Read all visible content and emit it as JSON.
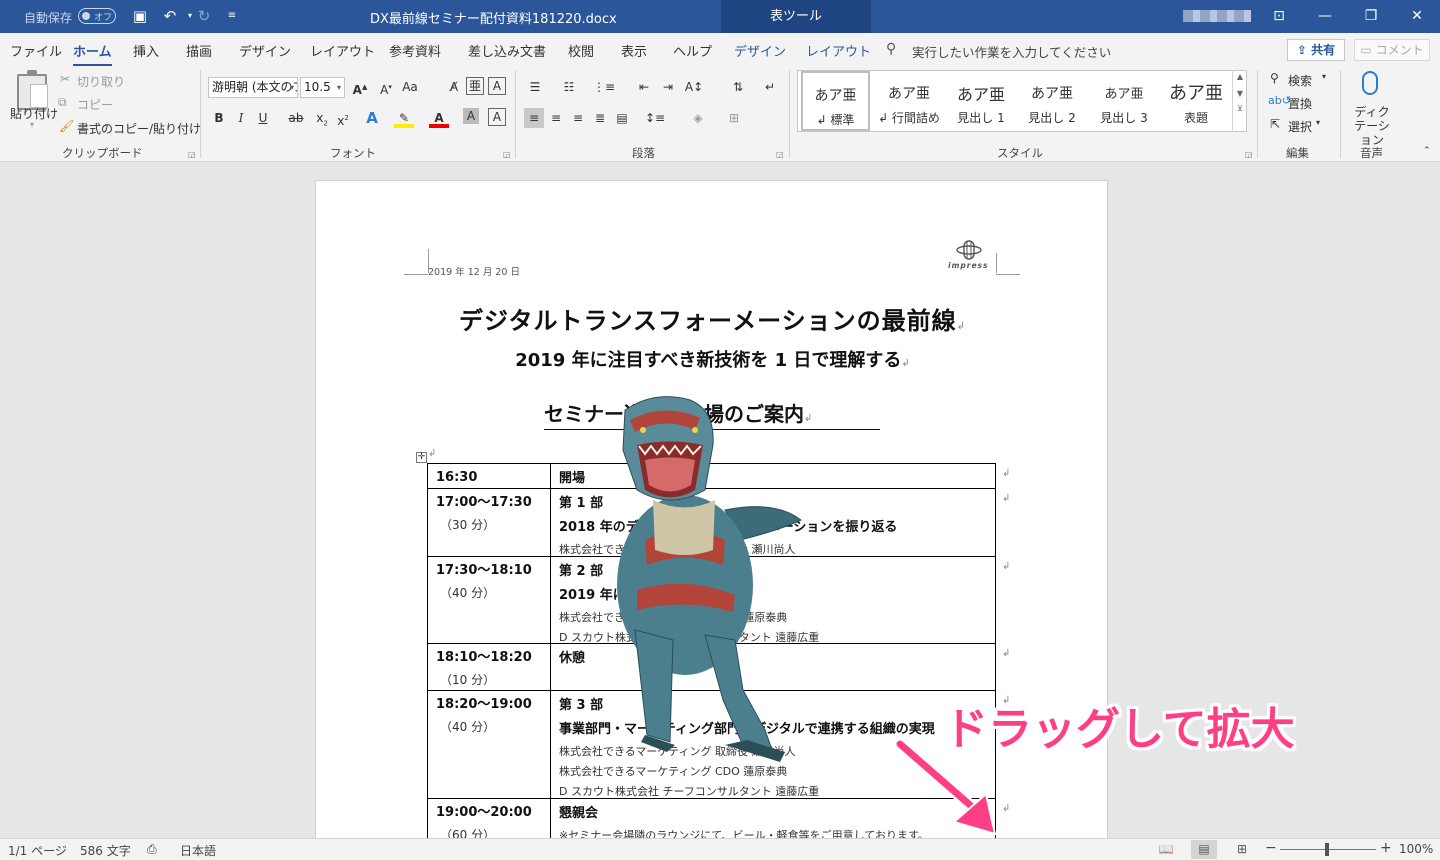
{
  "titlebar": {
    "autosave_label": "自動保存",
    "autosave_state": "オフ",
    "filename": "DX最前線セミナー配付資料181220.docx",
    "context_tab": "表ツール"
  },
  "tabs": [
    {
      "label": "ファイル"
    },
    {
      "label": "ホーム"
    },
    {
      "label": "挿入"
    },
    {
      "label": "描画"
    },
    {
      "label": "デザイン"
    },
    {
      "label": "レイアウト"
    },
    {
      "label": "参考資料"
    },
    {
      "label": "差し込み文書"
    },
    {
      "label": "校閲"
    },
    {
      "label": "表示"
    },
    {
      "label": "ヘルプ"
    },
    {
      "label": "デザイン"
    },
    {
      "label": "レイアウト"
    }
  ],
  "tell_me": "実行したい作業を入力してください",
  "share_label": "共有",
  "comment_label": "コメント",
  "clipboard": {
    "paste": "貼り付け",
    "cut": "切り取り",
    "copy": "コピー",
    "format_painter": "書式のコピー/貼り付け",
    "group": "クリップボード"
  },
  "font": {
    "name": "游明朝 (本文のフォント)",
    "size": "10.5",
    "group": "フォント"
  },
  "paragraph": {
    "group": "段落"
  },
  "styles": {
    "group": "スタイル",
    "items": [
      {
        "sample": "あア亜",
        "name": "↲ 標準"
      },
      {
        "sample": "あア亜",
        "name": "↲ 行間詰め"
      },
      {
        "sample": "あア亜",
        "name": "見出し 1"
      },
      {
        "sample": "あア亜",
        "name": "見出し 2"
      },
      {
        "sample": "あア亜",
        "name": "見出し 3"
      },
      {
        "sample": "あア亜",
        "name": "表題"
      }
    ]
  },
  "editing": {
    "find": "検索",
    "replace": "置換",
    "select": "選択",
    "group": "編集"
  },
  "voice": {
    "dictate": "ディクテーション",
    "group": "音声"
  },
  "document": {
    "header_date": "2019 年 12 月 20 日",
    "logo_text": "impress",
    "title": "デジタルトランスフォーメーションの最前線",
    "subtitle": "2019 年に注目すべき新技術を 1 日で理解する",
    "heading": "セミナー進行と会場のご案内",
    "schedule": [
      {
        "time": "16:30",
        "duration": "",
        "head": "開場",
        "title": "",
        "lines": []
      },
      {
        "time": "17:00～17:30",
        "duration": "（30 分）",
        "head": "第 1 部",
        "title": "2018 年のデジタルトランスフォーメーションを振り返る",
        "lines": [
          "株式会社できるマーケティング 取締役 瀬川尚人"
        ]
      },
      {
        "time": "17:30～18:10",
        "duration": "（40 分）",
        "head": "第 2 部",
        "title": "2019 年に注目すべき新技術",
        "lines": [
          "株式会社できるマーケティング CDO 蓮原泰典",
          "D スカウト株式会社 チーフコンサルタント 遠藤広重"
        ]
      },
      {
        "time": "18:10～18:20",
        "duration": "（10 分）",
        "head": "休憩",
        "title": "",
        "lines": []
      },
      {
        "time": "18:20～19:00",
        "duration": "（40 分）",
        "head": "第 3 部",
        "title": "事業部門・マーケティング部門がデジタルで連携する組織の実現",
        "lines": [
          "株式会社できるマーケティング 取締役 瀬川尚人",
          "株式会社できるマーケティング CDO 蓮原泰典",
          "D スカウト株式会社 チーフコンサルタント 遠藤広重"
        ]
      },
      {
        "time": "19:00～20:00",
        "duration": "（60 分）",
        "head": "懇親会",
        "title": "",
        "lines": [
          "※セミナー会場隣のラウンジにて、ビール・軽食等をご用意しております。"
        ]
      }
    ]
  },
  "annotation": "ドラッグして拡大",
  "statusbar": {
    "page": "1/1 ページ",
    "words": "586 文字",
    "language": "日本語",
    "zoom": "100%"
  },
  "colors": {
    "accent": "#2b579a",
    "annotation": "#ff3f85"
  }
}
